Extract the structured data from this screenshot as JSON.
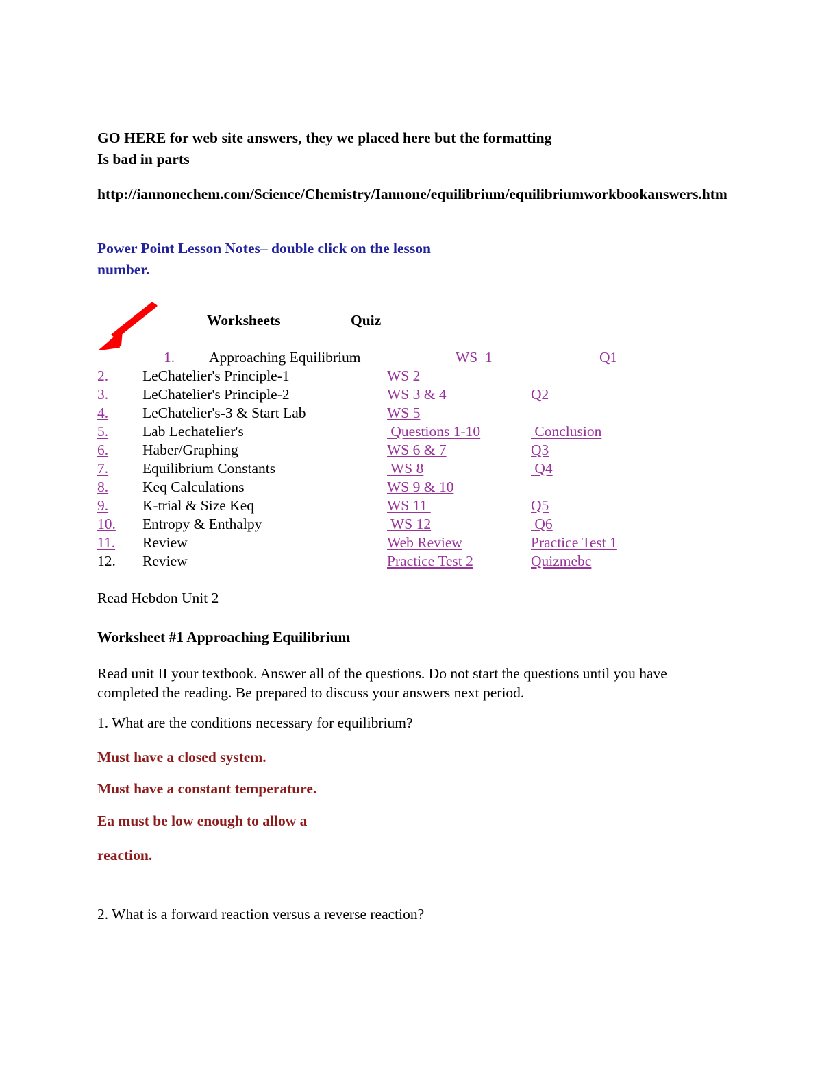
{
  "document": {
    "intro_lines": [
      "GO HERE for web site answers, they we placed here but the formatting",
      "Is bad in parts"
    ],
    "url": "http://iannonechem.com/Science/Chemistry/Iannone/equilibrium/equilibriumworkbookanswers.htm",
    "ppt_heading": "Power Point Lesson Notes– double click on the lesson number.",
    "table": {
      "headers": {
        "worksheets": "Worksheets",
        "quiz": "Quiz"
      },
      "rows": [
        {
          "num": "1.",
          "num_style": "purple",
          "title": "Approaching Equilibrium",
          "title_style": "plain",
          "ws": "WS  1",
          "ws_style": "purple",
          "quiz": "Q1",
          "quiz_style": "purple"
        },
        {
          "num": "2.",
          "num_style": "purple",
          "title": "LeChatelier's Principle-1",
          "title_style": "plain",
          "ws": "WS 2",
          "ws_style": "purple",
          "quiz": "",
          "quiz_style": "purple"
        },
        {
          "num": "3.",
          "num_style": "purple",
          "title": "LeChatelier's Principle-2",
          "title_style": "plain",
          "ws": "WS 3 & 4",
          "ws_style": "purple",
          "quiz": "Q2",
          "quiz_style": "purple"
        },
        {
          "num": "4.",
          "num_style": "purple-underline",
          "title": "LeChatelier's-3 & Start Lab",
          "title_style": "plain",
          "ws": "WS 5",
          "ws_style": "purple-underline",
          "quiz": "",
          "quiz_style": "purple"
        },
        {
          "num": "5.",
          "num_style": "purple-underline",
          "title": "Lab Lechatelier's",
          "title_style": "plain",
          "ws": " Questions 1-10",
          "ws_style": "purple-underline",
          "quiz": " Conclusion",
          "quiz_style": "purple-underline"
        },
        {
          "num": "6.",
          "num_style": "purple-underline",
          "title": "Haber/Graphing",
          "title_style": "plain",
          "ws": "WS 6 & 7",
          "ws_style": "purple-underline",
          "quiz": "Q3",
          "quiz_style": "purple-underline"
        },
        {
          "num": "7.",
          "num_style": "purple-underline",
          "title": "Equilibrium Constants",
          "title_style": "plain",
          "ws": " WS 8",
          "ws_style": "purple-underline",
          "quiz": " Q4",
          "quiz_style": "purple-underline"
        },
        {
          "num": "8.",
          "num_style": "purple-underline",
          "title": "Keq Calculations",
          "title_style": "plain",
          "ws": "WS 9 & 10",
          "ws_style": "purple-underline",
          "quiz": "",
          "quiz_style": "purple"
        },
        {
          "num": "9.",
          "num_style": "purple-underline",
          "title": "K-trial & Size Keq",
          "title_style": "plain",
          "ws": "WS 11 ",
          "ws_style": "purple-underline",
          "quiz": "Q5",
          "quiz_style": "purple-underline"
        },
        {
          "num": "10.",
          "num_style": "purple-underline",
          "title": "Entropy & Enthalpy",
          "title_style": "plain",
          "ws": " WS 12",
          "ws_style": "purple-underline",
          "quiz": " Q6",
          "quiz_style": "purple-underline"
        },
        {
          "num": "11.",
          "num_style": "purple-underline",
          "title": "Review",
          "title_style": "plain",
          "ws": "Web Review",
          "ws_style": "purple-underline",
          "quiz": "Practice Test 1",
          "quiz_style": "purple-underline"
        },
        {
          "num": "12.",
          "num_style": "plain",
          "title": "Review",
          "title_style": "plain",
          "ws": "Practice Test 2",
          "ws_style": "purple-underline",
          "quiz": "Quizmebc",
          "quiz_style": "purple-underline"
        }
      ]
    },
    "read_hebdon": "Read Hebdon Unit 2",
    "worksheet_title": "Worksheet #1 Approaching Equilibrium",
    "worksheet_intro": "Read unit II your textbook. Answer all of the questions. Do not start the questions until you have completed the reading. Be prepared to discuss your answers next period.",
    "question_1": "1. What are the conditions necessary for equilibrium?",
    "answers": [
      "Must have a closed system.",
      "Must have a constant temperature.",
      "Ea must be low enough to allow a",
      "reaction."
    ],
    "question_2": "2. What is a forward reaction versus a reverse reaction?"
  },
  "colors": {
    "link_purple": "#99339b",
    "heading_blue": "#22229c",
    "answer_red": "#8e1b1b",
    "arrow_red": "#fa0000"
  }
}
